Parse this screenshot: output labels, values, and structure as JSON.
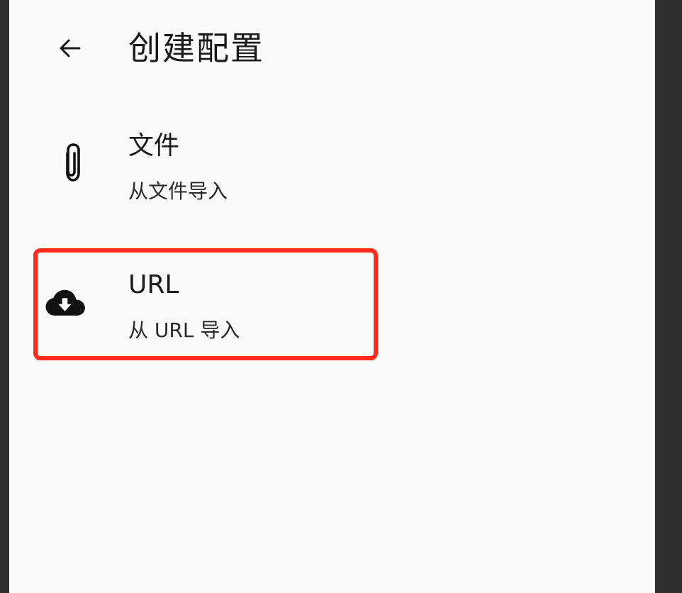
{
  "header": {
    "title": "创建配置",
    "back_icon": "arrow-left-icon"
  },
  "options": [
    {
      "title": "文件",
      "subtitle": "从文件导入",
      "icon": "paperclip-icon"
    },
    {
      "title": "URL",
      "subtitle": "从 URL 导入",
      "icon": "cloud-download-icon",
      "highlighted": true
    }
  ],
  "colors": {
    "background": "#fafafa",
    "text": "#1b1b1b",
    "highlight_border": "#ff2b1c",
    "frame": "#2f2f2f"
  }
}
